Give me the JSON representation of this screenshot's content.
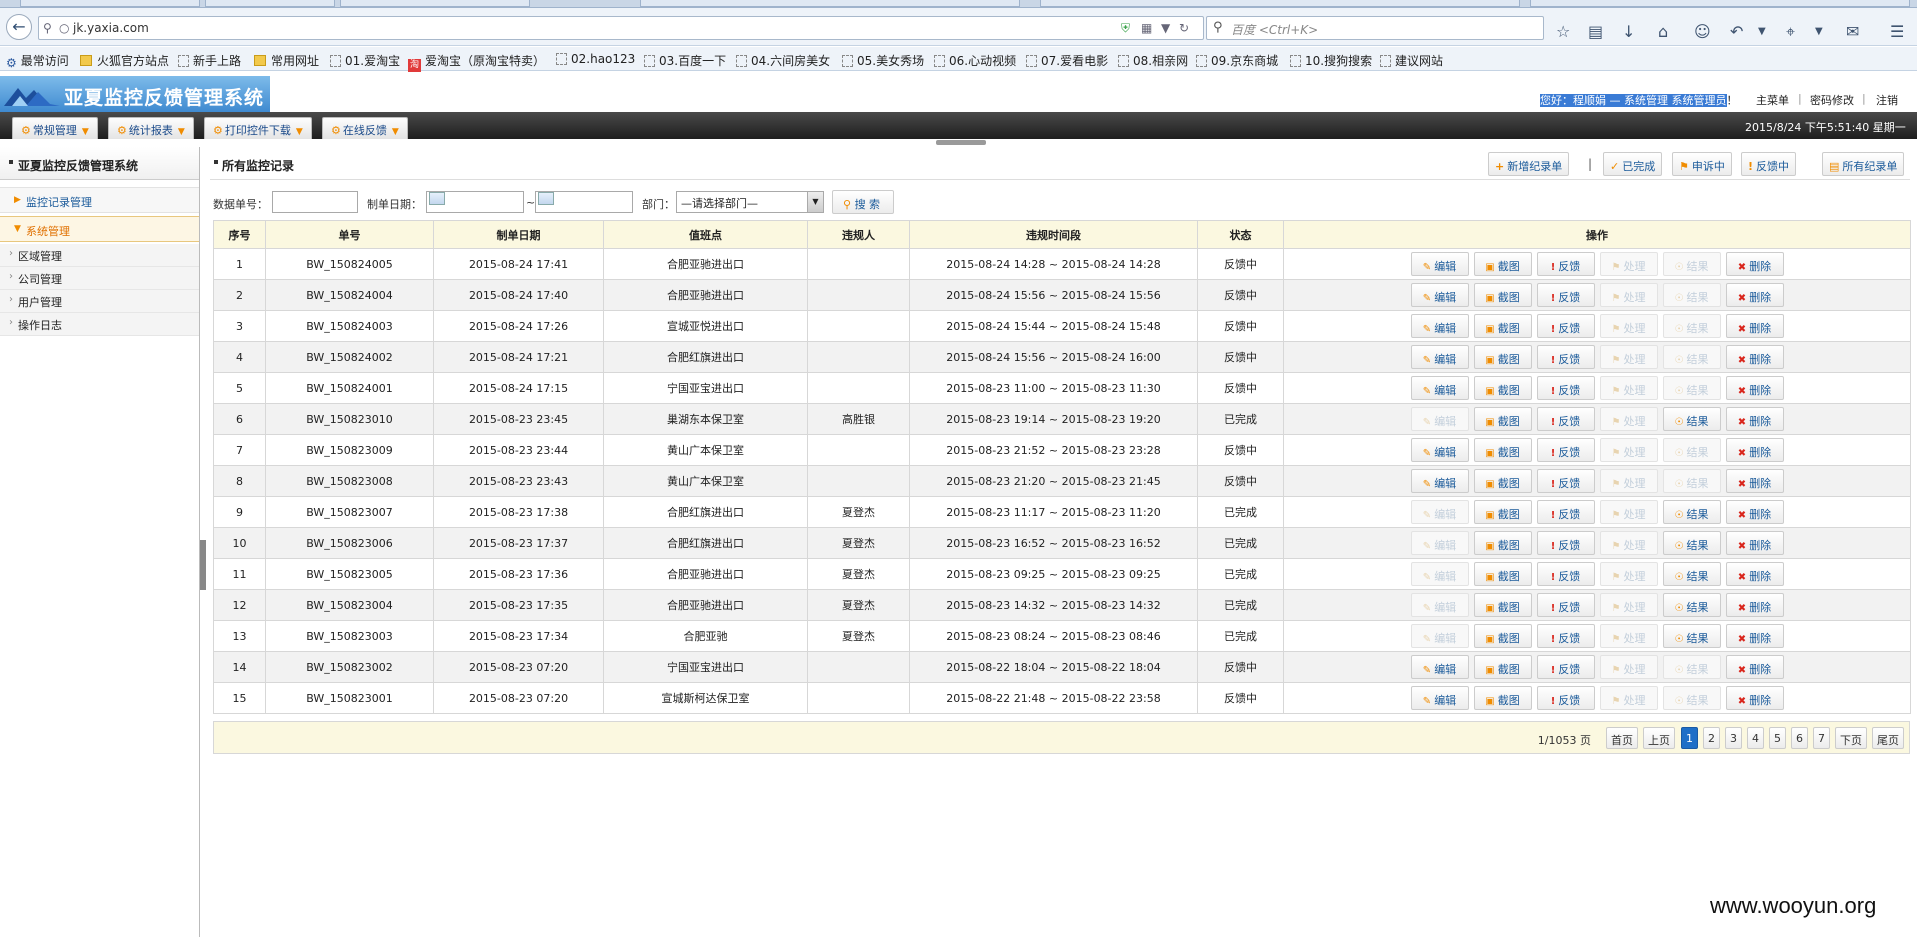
{
  "browser": {
    "url": "jk.yaxia.com",
    "search_placeholder": "百度 <Ctrl+K>",
    "bookmarks": [
      {
        "label": "最常访问",
        "type": "icon"
      },
      {
        "label": "火狐官方站点",
        "type": "folder"
      },
      {
        "label": "新手上路",
        "type": "icon"
      },
      {
        "label": "常用网址",
        "type": "folder"
      },
      {
        "label": "01.爱淘宝",
        "type": "icon"
      },
      {
        "label": "爱淘宝（原淘宝特卖）",
        "type": "red"
      },
      {
        "label": "02.hao123",
        "type": "icon"
      },
      {
        "label": "03.百度一下",
        "type": "icon"
      },
      {
        "label": "04.六间房美女",
        "type": "icon"
      },
      {
        "label": "05.美女秀场",
        "type": "icon"
      },
      {
        "label": "06.心动视频",
        "type": "icon"
      },
      {
        "label": "07.爱看电影",
        "type": "icon"
      },
      {
        "label": "08.相亲网",
        "type": "icon"
      },
      {
        "label": "09.京东商城",
        "type": "icon"
      },
      {
        "label": "10.搜狗搜索",
        "type": "icon"
      },
      {
        "label": "建议网站",
        "type": "icon"
      }
    ]
  },
  "app": {
    "title": "亚夏监控反馈管理系统",
    "welcome": "您好：程顺娟 — 系统管理 系统管理员",
    "welcome_suffix": "！",
    "top_links": [
      "主菜单",
      "密码修改",
      "注销"
    ],
    "menus": [
      "常规管理",
      "统计报表",
      "打印控件下载",
      "在线反馈"
    ],
    "datetime": "2015/8/24 下午5:51:40 星期一"
  },
  "sidebar": {
    "title": "亚夏监控反馈管理系统",
    "items": [
      "监控记录管理",
      "系统管理"
    ],
    "subitems": [
      "区域管理",
      "公司管理",
      "用户管理",
      "操作日志"
    ]
  },
  "main": {
    "title": "所有监控记录",
    "actions": [
      "新增纪录单",
      "已完成",
      "申诉中",
      "反馈中",
      "所有纪录单"
    ],
    "action_separator": "|",
    "filter": {
      "number_label": "数据单号：",
      "date_label": "制单日期：",
      "date_sep": "~",
      "dept_label": "部门：",
      "dept_selected": "—请选择部门—",
      "search_label": "搜 索"
    },
    "columns": [
      "序号",
      "单号",
      "制单日期",
      "值班点",
      "违规人",
      "违规时间段",
      "状态",
      "操作"
    ],
    "op_labels": [
      "编辑",
      "截图",
      "反馈",
      "处理",
      "结果",
      "删除"
    ],
    "rows": [
      {
        "no": "1",
        "id": "BW_150824005",
        "date": "2015-08-24 17:41",
        "post": "合肥亚驰进出口",
        "person": "",
        "period": "2015-08-24 14:28 ~ 2015-08-24 14:28",
        "status": "反馈中"
      },
      {
        "no": "2",
        "id": "BW_150824004",
        "date": "2015-08-24 17:40",
        "post": "合肥亚驰进出口",
        "person": "",
        "period": "2015-08-24 15:56 ~ 2015-08-24 15:56",
        "status": "反馈中"
      },
      {
        "no": "3",
        "id": "BW_150824003",
        "date": "2015-08-24 17:26",
        "post": "宣城亚悦进出口",
        "person": "",
        "period": "2015-08-24 15:44 ~ 2015-08-24 15:48",
        "status": "反馈中"
      },
      {
        "no": "4",
        "id": "BW_150824002",
        "date": "2015-08-24 17:21",
        "post": "合肥红旗进出口",
        "person": "",
        "period": "2015-08-24 15:56 ~ 2015-08-24 16:00",
        "status": "反馈中"
      },
      {
        "no": "5",
        "id": "BW_150824001",
        "date": "2015-08-24 17:15",
        "post": "宁国亚宝进出口",
        "person": "",
        "period": "2015-08-23 11:00 ~ 2015-08-23 11:30",
        "status": "反馈中"
      },
      {
        "no": "6",
        "id": "BW_150823010",
        "date": "2015-08-23 23:45",
        "post": "巢湖东本保卫室",
        "person": "高胜银",
        "period": "2015-08-23 19:14 ~ 2015-08-23 19:20",
        "status": "已完成"
      },
      {
        "no": "7",
        "id": "BW_150823009",
        "date": "2015-08-23 23:44",
        "post": "黄山广本保卫室",
        "person": "",
        "period": "2015-08-23 21:52 ~ 2015-08-23 23:28",
        "status": "反馈中"
      },
      {
        "no": "8",
        "id": "BW_150823008",
        "date": "2015-08-23 23:43",
        "post": "黄山广本保卫室",
        "person": "",
        "period": "2015-08-23 21:20 ~ 2015-08-23 21:45",
        "status": "反馈中"
      },
      {
        "no": "9",
        "id": "BW_150823007",
        "date": "2015-08-23 17:38",
        "post": "合肥红旗进出口",
        "person": "夏登杰",
        "period": "2015-08-23 11:17 ~ 2015-08-23 11:20",
        "status": "已完成"
      },
      {
        "no": "10",
        "id": "BW_150823006",
        "date": "2015-08-23 17:37",
        "post": "合肥红旗进出口",
        "person": "夏登杰",
        "period": "2015-08-23 16:52 ~ 2015-08-23 16:52",
        "status": "已完成"
      },
      {
        "no": "11",
        "id": "BW_150823005",
        "date": "2015-08-23 17:36",
        "post": "合肥亚驰进出口",
        "person": "夏登杰",
        "period": "2015-08-23 09:25 ~ 2015-08-23 09:25",
        "status": "已完成"
      },
      {
        "no": "12",
        "id": "BW_150823004",
        "date": "2015-08-23 17:35",
        "post": "合肥亚驰进出口",
        "person": "夏登杰",
        "period": "2015-08-23 14:32 ~ 2015-08-23 14:32",
        "status": "已完成"
      },
      {
        "no": "13",
        "id": "BW_150823003",
        "date": "2015-08-23 17:34",
        "post": "合肥亚驰",
        "person": "夏登杰",
        "period": "2015-08-23 08:24 ~ 2015-08-23 08:46",
        "status": "已完成"
      },
      {
        "no": "14",
        "id": "BW_150823002",
        "date": "2015-08-23 07:20",
        "post": "宁国亚宝进出口",
        "person": "",
        "period": "2015-08-22 18:04 ~ 2015-08-22 18:04",
        "status": "反馈中"
      },
      {
        "no": "15",
        "id": "BW_150823001",
        "date": "2015-08-23 07:20",
        "post": "宣城斯柯达保卫室",
        "person": "",
        "period": "2015-08-22 21:48 ~ 2015-08-22 23:58",
        "status": "反馈中"
      }
    ],
    "pager": {
      "info": "1/1053 页",
      "first": "首页",
      "prev": "上页",
      "pages": [
        "1",
        "2",
        "3",
        "4",
        "5",
        "6",
        "7"
      ],
      "current": "1",
      "next": "下页",
      "last": "尾页"
    }
  },
  "watermark": "www.wooyun.org"
}
